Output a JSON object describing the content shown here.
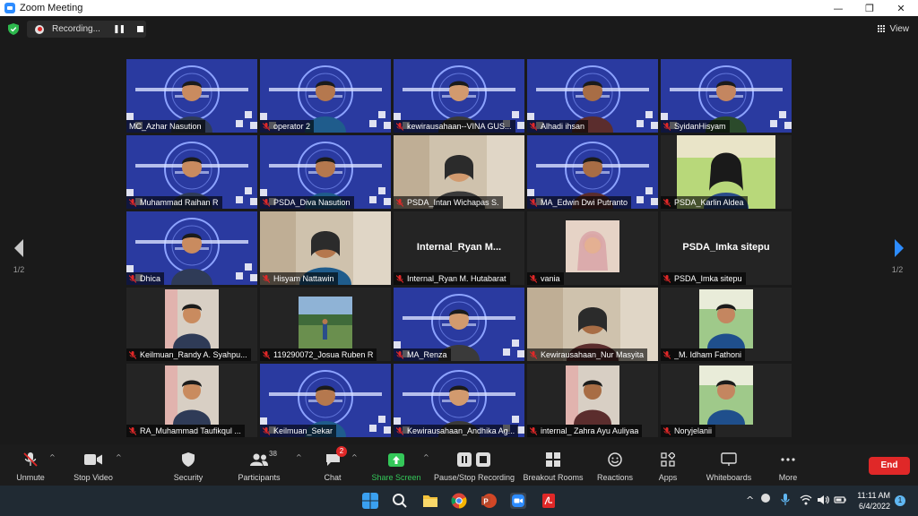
{
  "window": {
    "title": "Zoom Meeting",
    "minimize": "—",
    "restore": "❐",
    "close": "✕"
  },
  "topbar": {
    "recording_label": "Recording...",
    "view_label": "View"
  },
  "colors": {
    "accent_blue": "#2d8cff",
    "active_speaker": "#d5e35c",
    "end_red": "#e02828",
    "share_green": "#34c759"
  },
  "gallery": {
    "tiles": [
      {
        "name": "MC_Azhar Nasution",
        "active": true,
        "bg": "banner",
        "muted": false
      },
      {
        "name": "operator 2",
        "bg": "banner",
        "muted": true
      },
      {
        "name": "kewirausahaan--VINA GUS...",
        "bg": "banner",
        "muted": true
      },
      {
        "name": "Alhadi ihsan",
        "bg": "banner",
        "muted": true
      },
      {
        "name": "SyidanHisyam",
        "bg": "banner",
        "muted": true
      },
      {
        "name": "Muhammad Raihan R",
        "bg": "banner",
        "muted": true
      },
      {
        "name": "PSDA_Diva Nasution",
        "bg": "banner",
        "muted": true
      },
      {
        "name": "PSDA_Intan Wichapas S.",
        "bg": "room",
        "muted": true
      },
      {
        "name": "MA_Edwin Dwi Putranto",
        "bg": "banner",
        "muted": true
      },
      {
        "name": "PSDA_Karlin Aldea",
        "bg": "green",
        "muted": true
      },
      {
        "name": "Dhica",
        "bg": "banner",
        "muted": true
      },
      {
        "name": "Hisyam Nattawin",
        "bg": "room",
        "muted": true
      },
      {
        "name": "Internal_Ryan M. Hutabarat",
        "bg": "text",
        "big": "Internal_Ryan  M...",
        "muted": true
      },
      {
        "name": "vania",
        "bg": "small-photo",
        "muted": true
      },
      {
        "name": "PSDA_Imka sitepu",
        "bg": "text",
        "big": "PSDA_Imka sitepu",
        "muted": true
      },
      {
        "name": "Keilmuan_Randy A. Syahpu...",
        "bg": "small-room",
        "muted": true
      },
      {
        "name": "119290072_Josua Ruben R",
        "bg": "small-outdoor",
        "muted": true
      },
      {
        "name": "MA_Renza",
        "bg": "banner",
        "muted": true
      },
      {
        "name": "Kewirausahaan_Nur Masyita",
        "bg": "room",
        "muted": true
      },
      {
        "name": "_M. Idham Fathoni",
        "bg": "small-green",
        "muted": true
      },
      {
        "name": "RA_Muhammad Taufikqul ...",
        "bg": "small-room",
        "muted": true
      },
      {
        "name": "Keilmuan_Sekar",
        "bg": "banner",
        "muted": true
      },
      {
        "name": "Kewirausahaan_Andhika Ag...",
        "bg": "banner",
        "muted": true
      },
      {
        "name": "internal_ Zahra Ayu Auliyaa",
        "bg": "small-room",
        "muted": true
      },
      {
        "name": "Noryjelanii",
        "bg": "small-green",
        "muted": true
      }
    ],
    "page_left": "1/2",
    "page_right": "1/2"
  },
  "toolbar": {
    "unmute": "Unmute",
    "stop_video": "Stop Video",
    "security": "Security",
    "participants": "Participants",
    "participants_count": "38",
    "chat": "Chat",
    "chat_badge": "2",
    "share_screen": "Share Screen",
    "pause_recording": "Pause/Stop Recording",
    "breakout_rooms": "Breakout Rooms",
    "reactions": "Reactions",
    "apps": "Apps",
    "whiteboards": "Whiteboards",
    "more": "More",
    "end": "End"
  },
  "taskbar": {
    "time": "11:11 AM",
    "date": "6/4/2022",
    "notifications": "1"
  }
}
